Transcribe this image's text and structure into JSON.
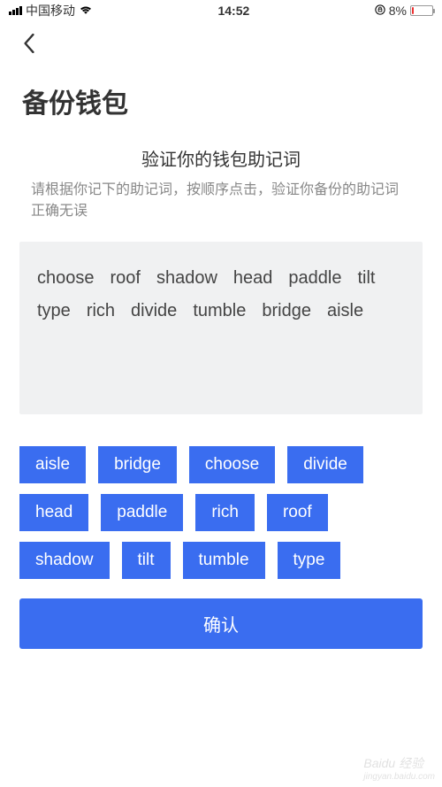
{
  "status_bar": {
    "carrier": "中国移动",
    "time": "14:52",
    "battery_percent": "8%"
  },
  "page": {
    "title": "备份钱包",
    "subtitle": "验证你的钱包助记词",
    "instruction": "请根据你记下的助记词，按顺序点击，验证你备份的助记词正确无误",
    "confirm_label": "确认"
  },
  "selected_words": [
    "choose",
    "roof",
    "shadow",
    "head",
    "paddle",
    "tilt",
    "type",
    "rich",
    "divide",
    "tumble",
    "bridge",
    "aisle"
  ],
  "word_chips": [
    "aisle",
    "bridge",
    "choose",
    "divide",
    "head",
    "paddle",
    "rich",
    "roof",
    "shadow",
    "tilt",
    "tumble",
    "type"
  ],
  "watermark": {
    "main": "Baidu 经验",
    "sub": "jingyan.baidu.com"
  }
}
